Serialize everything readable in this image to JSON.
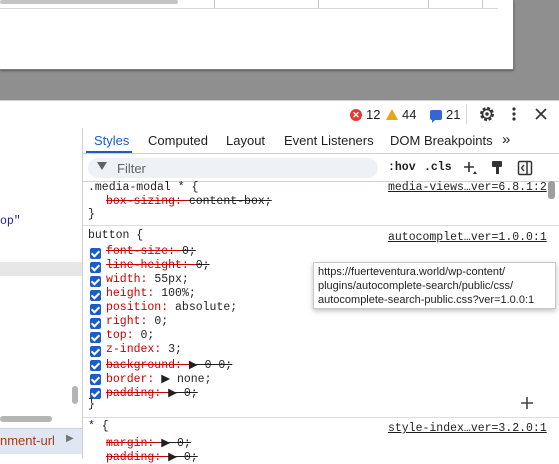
{
  "topbar": {
    "errors": "12",
    "warnings": "44",
    "messages": "21"
  },
  "left_panel": {
    "snippet": "op\"",
    "breadcrumb": "nment-url"
  },
  "tabs": [
    "Styles",
    "Computed",
    "Layout",
    "Event Listeners",
    "DOM Breakpoints"
  ],
  "more_tabs_glyph": "»",
  "filter": {
    "placeholder": "Filter",
    "hov": ":hov",
    "cls": ".cls"
  },
  "rules": [
    {
      "selector": ".media-modal * {",
      "source": "media-views…ver=6.8.1:2",
      "props": [
        {
          "name": "box-sizing",
          "value": "content-box;",
          "struck": true,
          "checkbox": false
        }
      ],
      "close": "}"
    },
    {
      "selector": "button {",
      "source": "autocomplet…ver=1.0.0:1",
      "props": [
        {
          "name": "font-size",
          "value": "0;",
          "struck": true
        },
        {
          "name": "line-height",
          "value": "0;",
          "struck": true
        },
        {
          "name": "width",
          "value": "55px;",
          "struck": false
        },
        {
          "name": "height",
          "value": "100%;",
          "struck": false
        },
        {
          "name": "position",
          "value": "absolute;",
          "struck": false
        },
        {
          "name": "right",
          "value": "0;",
          "struck": false
        },
        {
          "name": "top",
          "value": "0;",
          "struck": false
        },
        {
          "name": "z-index",
          "value": "3;",
          "struck": false
        },
        {
          "name": "background",
          "value": "▶ 0 0;",
          "struck": true
        },
        {
          "name": "border",
          "value": "▶ none;",
          "struck": false
        },
        {
          "name": "padding",
          "value": "▶ 0;",
          "struck": true
        }
      ],
      "close": "}"
    },
    {
      "selector": "* {",
      "source": "style-index…ver=3.2.0:1",
      "props": [
        {
          "name": "margin",
          "value": "▶ 0;",
          "struck": true
        },
        {
          "name": "padding",
          "value": "▶ 0;",
          "struck": true
        }
      ]
    }
  ],
  "tooltip": {
    "line1": "https://fuerteventura.world/wp-content/",
    "line2": "plugins/autocomplete-search/public/css/",
    "line3": "autocomplete-search-public.css?ver=1.0.0:1"
  },
  "colors": {
    "accent": "#1a5dc7",
    "prop_name": "#c80000",
    "error": "#e33a2b",
    "warning": "#e8a417"
  }
}
